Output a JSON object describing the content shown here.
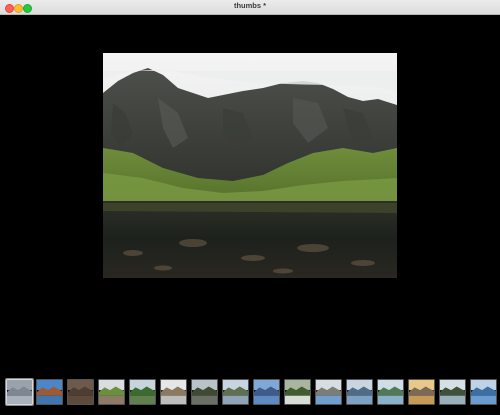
{
  "window": {
    "title": "thumbs *"
  },
  "main_photo": {
    "subject": "mountain-lake-photo"
  },
  "thumbnails": [
    {
      "name": "thumbnail-1",
      "sky": "#9aa3ad",
      "land": "#7d8791",
      "water": "#a9b2bc",
      "selected": true
    },
    {
      "name": "thumbnail-2",
      "sky": "#4b86c8",
      "land": "#9c5a36",
      "water": "#3f76b0",
      "selected": false
    },
    {
      "name": "thumbnail-3",
      "sky": "#6e5a4d",
      "land": "#4e3d33",
      "water": "#5c4a3c",
      "selected": false
    },
    {
      "name": "thumbnail-4",
      "sky": "#d9dde0",
      "land": "#6b8f3c",
      "water": "#8c7a66",
      "selected": false
    },
    {
      "name": "thumbnail-5",
      "sky": "#c8d4dc",
      "land": "#3b6b2f",
      "water": "#5f7f4e",
      "selected": false
    },
    {
      "name": "thumbnail-6",
      "sky": "#e6e6e6",
      "land": "#8a7a60",
      "water": "#bdbdbd",
      "selected": false
    },
    {
      "name": "thumbnail-7",
      "sky": "#b8c3c9",
      "land": "#3f4a32",
      "water": "#6a6f66",
      "selected": false
    },
    {
      "name": "thumbnail-8",
      "sky": "#c7d5e2",
      "land": "#5e6f52",
      "water": "#8fa4b7",
      "selected": false
    },
    {
      "name": "thumbnail-9",
      "sky": "#7fa8d8",
      "land": "#3d5c8a",
      "water": "#5f89c2",
      "selected": false
    },
    {
      "name": "thumbnail-10",
      "sky": "#a8b6a1",
      "land": "#3f5d2e",
      "water": "#d8dcd6",
      "selected": false
    },
    {
      "name": "thumbnail-11",
      "sky": "#d8dde2",
      "land": "#7c7d76",
      "water": "#6f9fcf",
      "selected": false
    },
    {
      "name": "thumbnail-12",
      "sky": "#c9d6e2",
      "land": "#4f6b86",
      "water": "#7ea0c4",
      "selected": false
    },
    {
      "name": "thumbnail-13",
      "sky": "#cfdde6",
      "land": "#4f7a55",
      "water": "#8bb0c9",
      "selected": false
    },
    {
      "name": "thumbnail-14",
      "sky": "#e9c98a",
      "land": "#7b6a55",
      "water": "#c69a57",
      "selected": false
    },
    {
      "name": "thumbnail-15",
      "sky": "#d6dfe6",
      "land": "#40513a",
      "water": "#9aaebc",
      "selected": false
    },
    {
      "name": "thumbnail-16",
      "sky": "#bfd3e6",
      "land": "#3d6fa3",
      "water": "#6a9cd0",
      "selected": false
    }
  ]
}
